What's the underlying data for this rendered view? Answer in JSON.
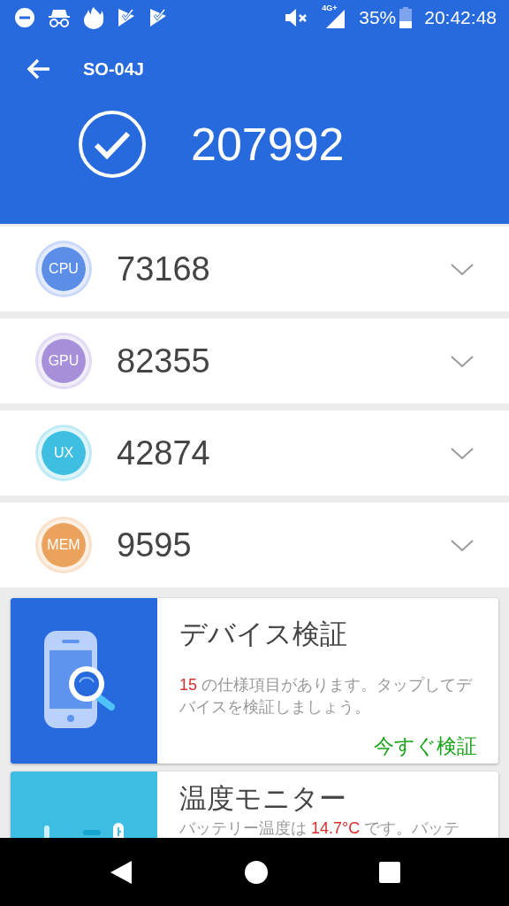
{
  "status_bar": {
    "network_label": "4G+",
    "battery": "35%",
    "time": "20:42:48"
  },
  "header": {
    "title": "SO-04J",
    "total_score": "207992"
  },
  "scores": [
    {
      "label": "CPU",
      "value": "73168",
      "color": "#5c8ee8",
      "expanded": false
    },
    {
      "label": "GPU",
      "value": "82355",
      "color": "#a88fd9",
      "expanded": false
    },
    {
      "label": "UX",
      "value": "42874",
      "color": "#3ebfe2",
      "expanded": false
    },
    {
      "label": "MEM",
      "value": "9595",
      "color": "#eaa25c",
      "expanded": false
    }
  ],
  "cards": [
    {
      "kind": "verify",
      "title": "デバイス検証",
      "highlight": "15",
      "text_after": " の仕様項目があります。タップしてデバイスを検証しましょう。",
      "action": "今すぐ検証"
    },
    {
      "kind": "temperature",
      "title": "温度モニター",
      "text_before": "バッテリー温度は ",
      "highlight": "14.7°C",
      "text_after": " です。バッテ"
    }
  ]
}
